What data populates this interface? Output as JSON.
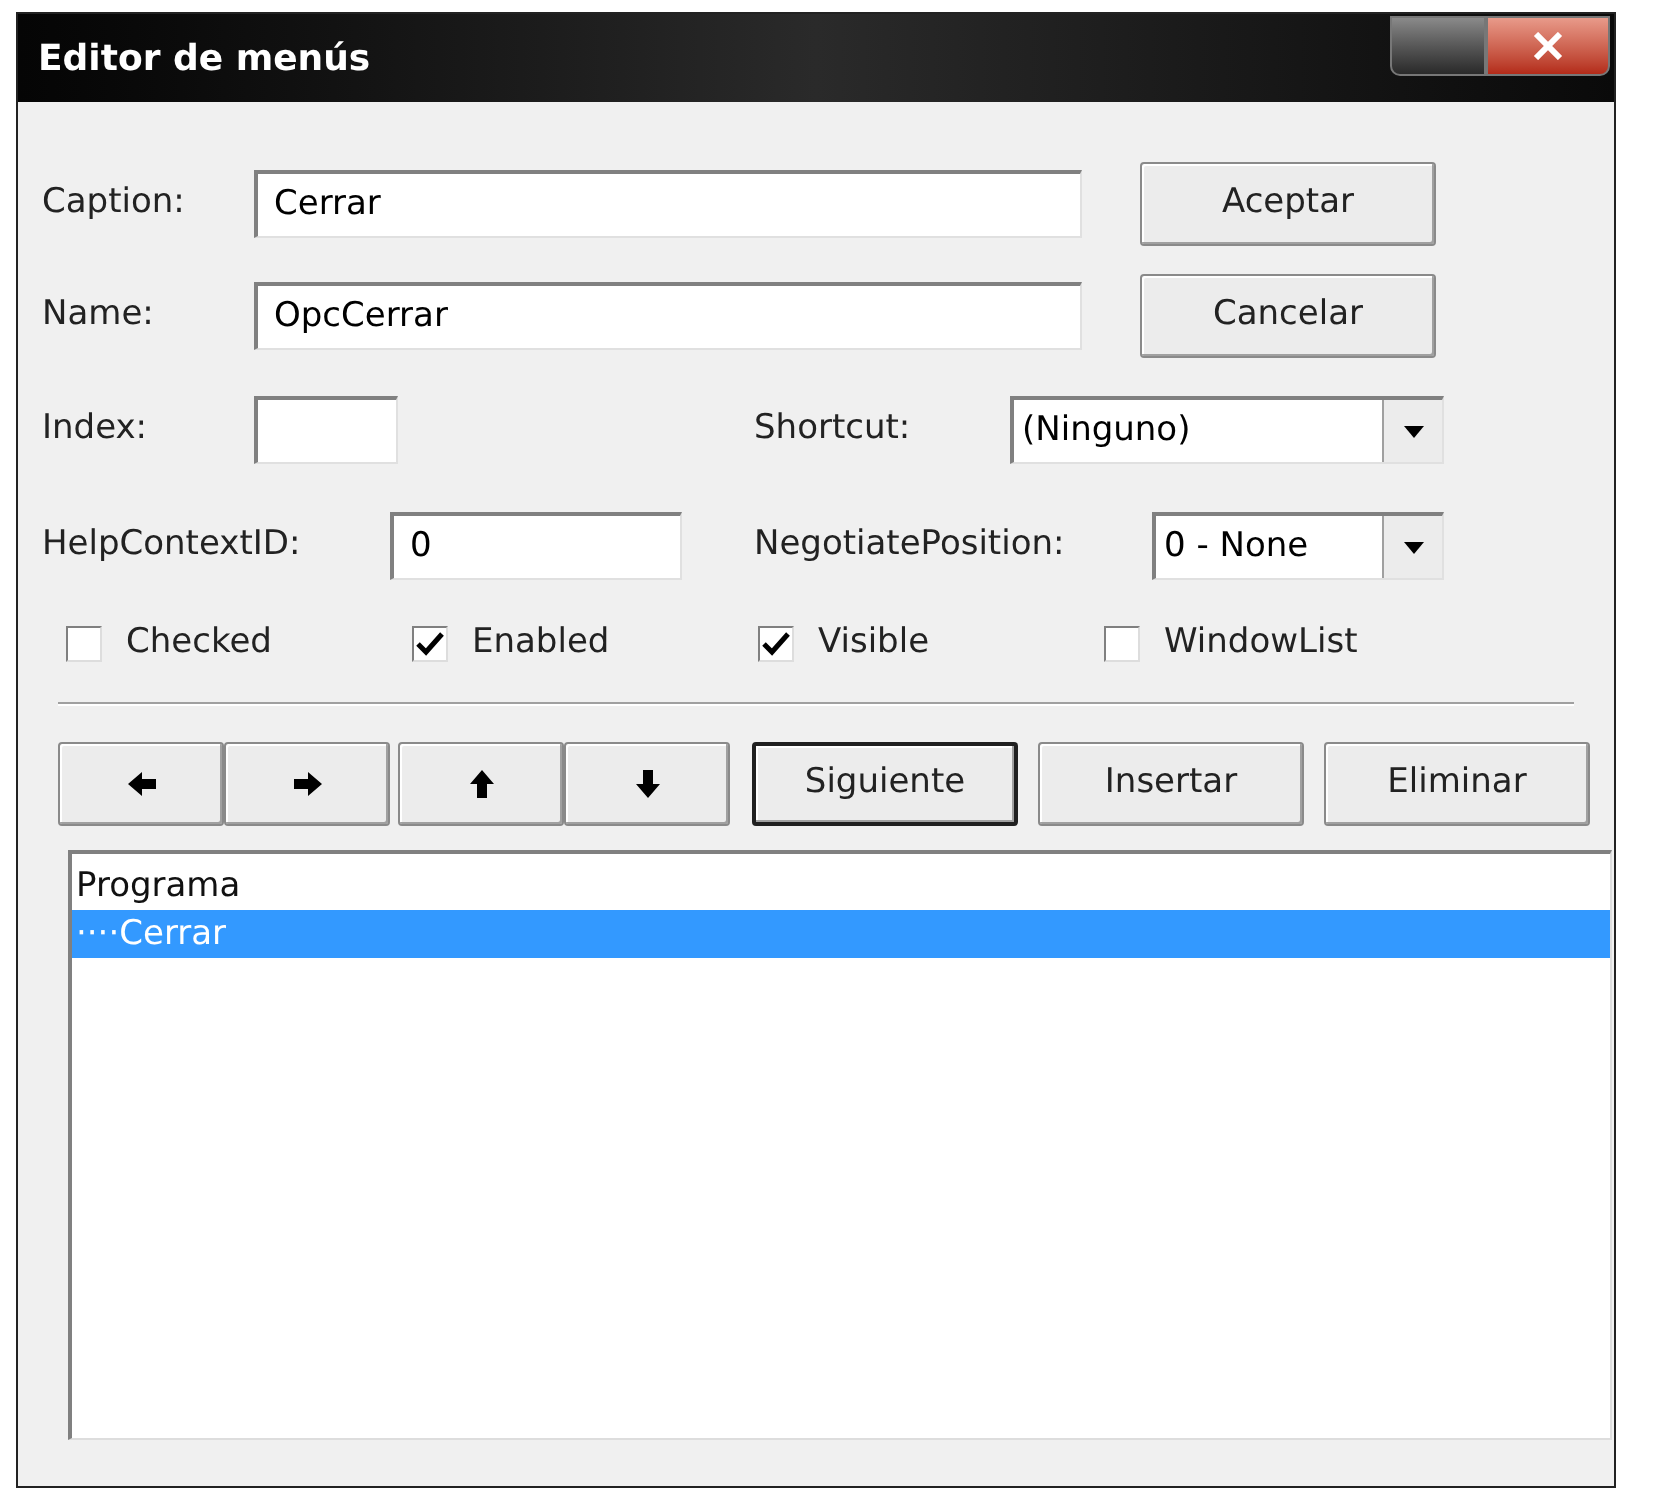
{
  "window": {
    "title": "Editor de menús"
  },
  "fields": [
    {
      "label": "Caption:",
      "value": "Cerrar"
    },
    {
      "label": "Name:",
      "value": "OpcCerrar"
    },
    {
      "label": "Index:"
    },
    {
      "label": "HelpContextID:",
      "value": "0"
    }
  ],
  "dropdowns": [
    {
      "label": "Shortcut:",
      "value": "(Ninguno)"
    },
    {
      "label": "NegotiatePosition:",
      "value": "0 - None"
    }
  ],
  "dialog_buttons": [
    {
      "label": "Aceptar"
    },
    {
      "label": "Cancelar"
    }
  ],
  "checkboxes": [
    {
      "label": "Checked",
      "checked": false
    },
    {
      "label": "Enabled",
      "checked": true
    },
    {
      "label": "Visible",
      "checked": true
    },
    {
      "label": "WindowList",
      "checked": false
    }
  ],
  "arrow_buttons": [
    {
      "kind": "left"
    },
    {
      "kind": "right"
    },
    {
      "kind": "up"
    },
    {
      "kind": "down"
    }
  ],
  "action_buttons": [
    {
      "label": "Siguiente",
      "default": true
    },
    {
      "label": "Insertar",
      "default": false
    },
    {
      "label": "Eliminar",
      "default": false
    }
  ],
  "menu_list": [
    {
      "text": "Programa",
      "selected": false
    },
    {
      "text": "····Cerrar",
      "selected": true
    }
  ]
}
